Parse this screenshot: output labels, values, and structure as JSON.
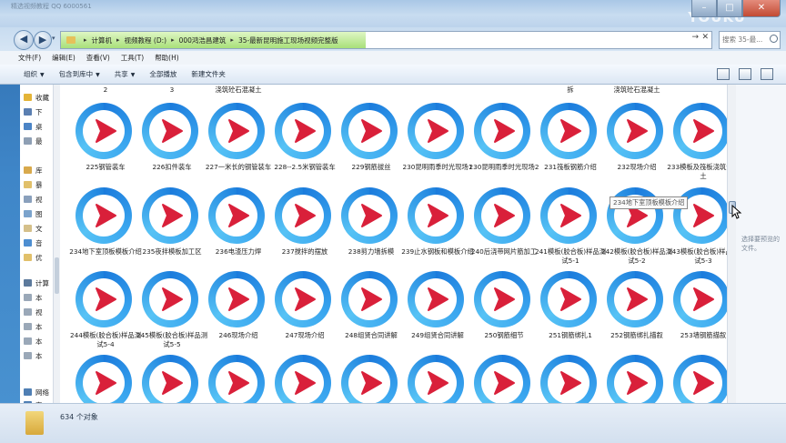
{
  "window": {
    "title": "精选视频教程 QQ 6000561",
    "watermark": "YOUKU",
    "caption_buttons": {
      "minimize": "–",
      "maximize": "□",
      "close": "✕"
    }
  },
  "address": {
    "crumbs": [
      "计算机",
      "视频教程 (D:)",
      "000鸿浩昌建筑",
      "35-最新昆明施工现场视频完整版"
    ],
    "search_placeholder": "搜索 35-最..."
  },
  "menu": [
    "文件(F)",
    "编辑(E)",
    "查看(V)",
    "工具(T)",
    "帮助(H)"
  ],
  "toolbar": [
    "组织",
    "包含到库中",
    "共享",
    "全部播放",
    "新建文件夹"
  ],
  "toolbar_has_caret": [
    true,
    true,
    true,
    false,
    false
  ],
  "navpane": [
    {
      "label": "收藏",
      "icon": "star-icon",
      "color": "#e4b437"
    },
    {
      "label": "下",
      "icon": "download-folder-icon",
      "color": "#5b7fb1"
    },
    {
      "label": "桌",
      "icon": "desktop-icon",
      "color": "#4b84c6"
    },
    {
      "label": "最",
      "icon": "recent-icon",
      "color": "#8e9fb4"
    },
    {
      "label": "库",
      "icon": "library-icon",
      "color": "#d8a94c"
    },
    {
      "label": "暴",
      "icon": "folder-icon",
      "color": "#e1c06a"
    },
    {
      "label": "视",
      "icon": "video-icon",
      "color": "#8aa0bc"
    },
    {
      "label": "图",
      "icon": "picture-icon",
      "color": "#7ba3cc"
    },
    {
      "label": "文",
      "icon": "document-icon",
      "color": "#d5c08a"
    },
    {
      "label": "音",
      "icon": "music-icon",
      "color": "#4d8ed1"
    },
    {
      "label": "优",
      "icon": "folder-icon",
      "color": "#e1c06a"
    },
    {
      "label": "计算",
      "icon": "computer-icon",
      "color": "#5c7a9c"
    },
    {
      "label": "本",
      "icon": "drive-icon",
      "color": "#9aa8b8"
    },
    {
      "label": "视",
      "icon": "drive-icon",
      "color": "#9aa8b8"
    },
    {
      "label": "本",
      "icon": "drive-icon",
      "color": "#9aa8b8"
    },
    {
      "label": "本",
      "icon": "drive-icon",
      "color": "#9aa8b8"
    },
    {
      "label": "本",
      "icon": "drive-icon",
      "color": "#9aa8b8"
    },
    {
      "label": "网络",
      "icon": "network-icon",
      "color": "#4f7fb4"
    },
    {
      "label": "家",
      "icon": "homegroup-icon",
      "color": "#4f7fb4"
    }
  ],
  "top_partial_labels": [
    "2",
    "3",
    "浇筑砼石混凝土",
    "",
    "",
    "",
    "",
    "拆",
    "浇筑砼石混凝土",
    "",
    ""
  ],
  "rows": [
    [
      "225钢管装车",
      "226扣件装车",
      "227一米长的钢管装车",
      "228--2.5米钢管装车",
      "229钢筋拔丝",
      "230昆明雨季时光现场1",
      "230昆明雨季时光现场2",
      "231筏板钢筋介绍",
      "232现场介绍",
      "233模板及筏板浇筑混凝土"
    ],
    [
      "234地下室顶板模板介绍",
      "235夜拌模板加工区",
      "236电渣压力焊",
      "237搅拌的摆放",
      "238剪力墙拆模",
      "239止水钢板和模板介绍",
      "240后浇带网片筋加工",
      "241模板(胶合板)样品测试5-1",
      "242模板(胶合板)样品测试5-2",
      "243模板(胶合板)样品测试5-3"
    ],
    [
      "244模板(胶合板)样品测试5-4",
      "245模板(胶合板)样品测试5-5",
      "246现场介绍",
      "247现场介绍",
      "248组贤合同讲解",
      "249组贤合同讲解",
      "250钢筋细节",
      "251钢筋绑扎1",
      "252钢筋绑扎描叙",
      "253墙钢筋描叙"
    ],
    [
      "",
      "",
      "",
      "",
      "",
      "",
      "",
      "",
      "",
      ""
    ]
  ],
  "tooltip": "234地下室顶板模板介绍",
  "preview_text": "选择要预览的文件。",
  "status": {
    "count_text": "634 个对象"
  },
  "colors": {
    "accent": "#1b7bdc",
    "play": "#d9203a"
  }
}
